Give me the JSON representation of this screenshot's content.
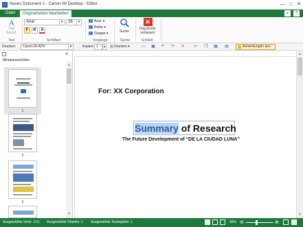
{
  "window": {
    "title": "Neues Dokument 1 - Canon iW Desktop - Editor",
    "buttons": [
      "—",
      "□",
      "✕"
    ]
  },
  "tabs": {
    "file": "Datei",
    "active": "Originalseiten bearbeiten"
  },
  "ribbon": {
    "text_group": {
      "label": "Text",
      "button": "Text\nhinzuf."
    },
    "font_group": {
      "label": "Schriftart",
      "font": "Arial",
      "size": "26",
      "bold": "F",
      "italic": "K",
      "color": "A"
    },
    "process_group": {
      "label": "Vorgänge",
      "items": [
        "Ausr.",
        "Reihe",
        "Gruppe"
      ]
    },
    "search_group": {
      "label": "Suche",
      "button": "Suche"
    },
    "close_group": {
      "label": "Schließ",
      "button": "Orig.bearb.\nverlassen"
    }
  },
  "printbar": {
    "print_label": "Drucken:",
    "printer": "Canon iR-ADV",
    "copies_label": "Kopien:",
    "copies": "1",
    "print_button": "Drucken",
    "annotations_button": "Anmerkungen anz."
  },
  "thumbnails": {
    "title": "Miniaturansichten",
    "pages": [
      "1",
      "2",
      "3"
    ]
  },
  "document": {
    "for_line": "For: XX Corporation",
    "title_highlight": "Summary",
    "title_rest": " of Research",
    "subtitle": "The Future Development of “DE LA CIUDAD LUNA”"
  },
  "status": {
    "series": "Ausgewählte Serie: 1/11",
    "objects": "Ausgewählte Objekte: 1",
    "textobjects": "Ausgewählte Textobjekte: 1",
    "zoom": "90%"
  },
  "colors": {
    "accent": "#1e7a3c",
    "highlight": "#b6d3f2",
    "close_red": "#d9342b"
  }
}
